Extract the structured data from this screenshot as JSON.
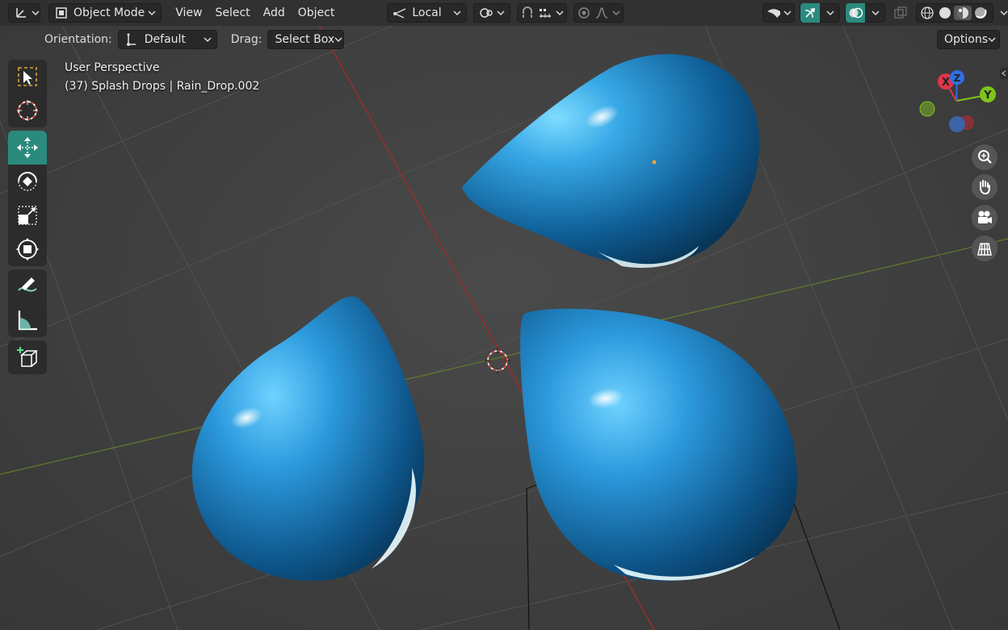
{
  "header": {
    "editor_type_icon": "axis-icon",
    "mode": "Object Mode",
    "menus": [
      "View",
      "Select",
      "Add",
      "Object"
    ],
    "transform_pivot": "Local",
    "snapping_icon": "magnet-icon",
    "proportional_icon": "circle-icon"
  },
  "subheader": {
    "orientation_label": "Orientation:",
    "orientation_value": "Default",
    "drag_label": "Drag:",
    "drag_value": "Select Box",
    "options_label": "Options"
  },
  "viewport": {
    "perspective_label": "User Perspective",
    "object_info": "(37) Splash Drops | Rain_Drop.002"
  },
  "gizmo": {
    "x_label": "X",
    "y_label": "Y",
    "z_label": "Z",
    "x_color": "#e0364a",
    "y_color": "#7fc51a",
    "z_color": "#2e6fe5"
  },
  "toolbar": {
    "tools": [
      "select-box",
      "cursor",
      "move",
      "rotate",
      "scale",
      "transform",
      "annotate",
      "measure",
      "add-cube"
    ],
    "active_tool": "move"
  },
  "colors": {
    "accent": "#2b8a7e",
    "drop_light": "#5cc8ff",
    "drop_dark": "#0a3b63",
    "x_axis": "#a33333",
    "y_axis": "#6b8e23"
  }
}
